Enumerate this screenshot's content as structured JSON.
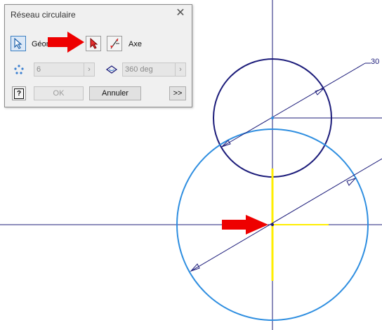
{
  "dialog": {
    "title": "Réseau circulaire",
    "close_glyph": "✕",
    "geometry_label": "Géom",
    "axis_label": "Axe",
    "count_value": "6",
    "angle_value": "360 deg",
    "help_glyph": "?",
    "ok_label": "OK",
    "cancel_label": "Annuler",
    "more_label": ">>"
  },
  "canvas": {
    "dimension_text": "30",
    "colors": {
      "dark_circle": "#1c1c7a",
      "selected_circle": "#2e8ee0",
      "axis_line": "#1c1c7a",
      "highlight_axis": "#ffee00",
      "arrow": "#ee0000"
    }
  }
}
